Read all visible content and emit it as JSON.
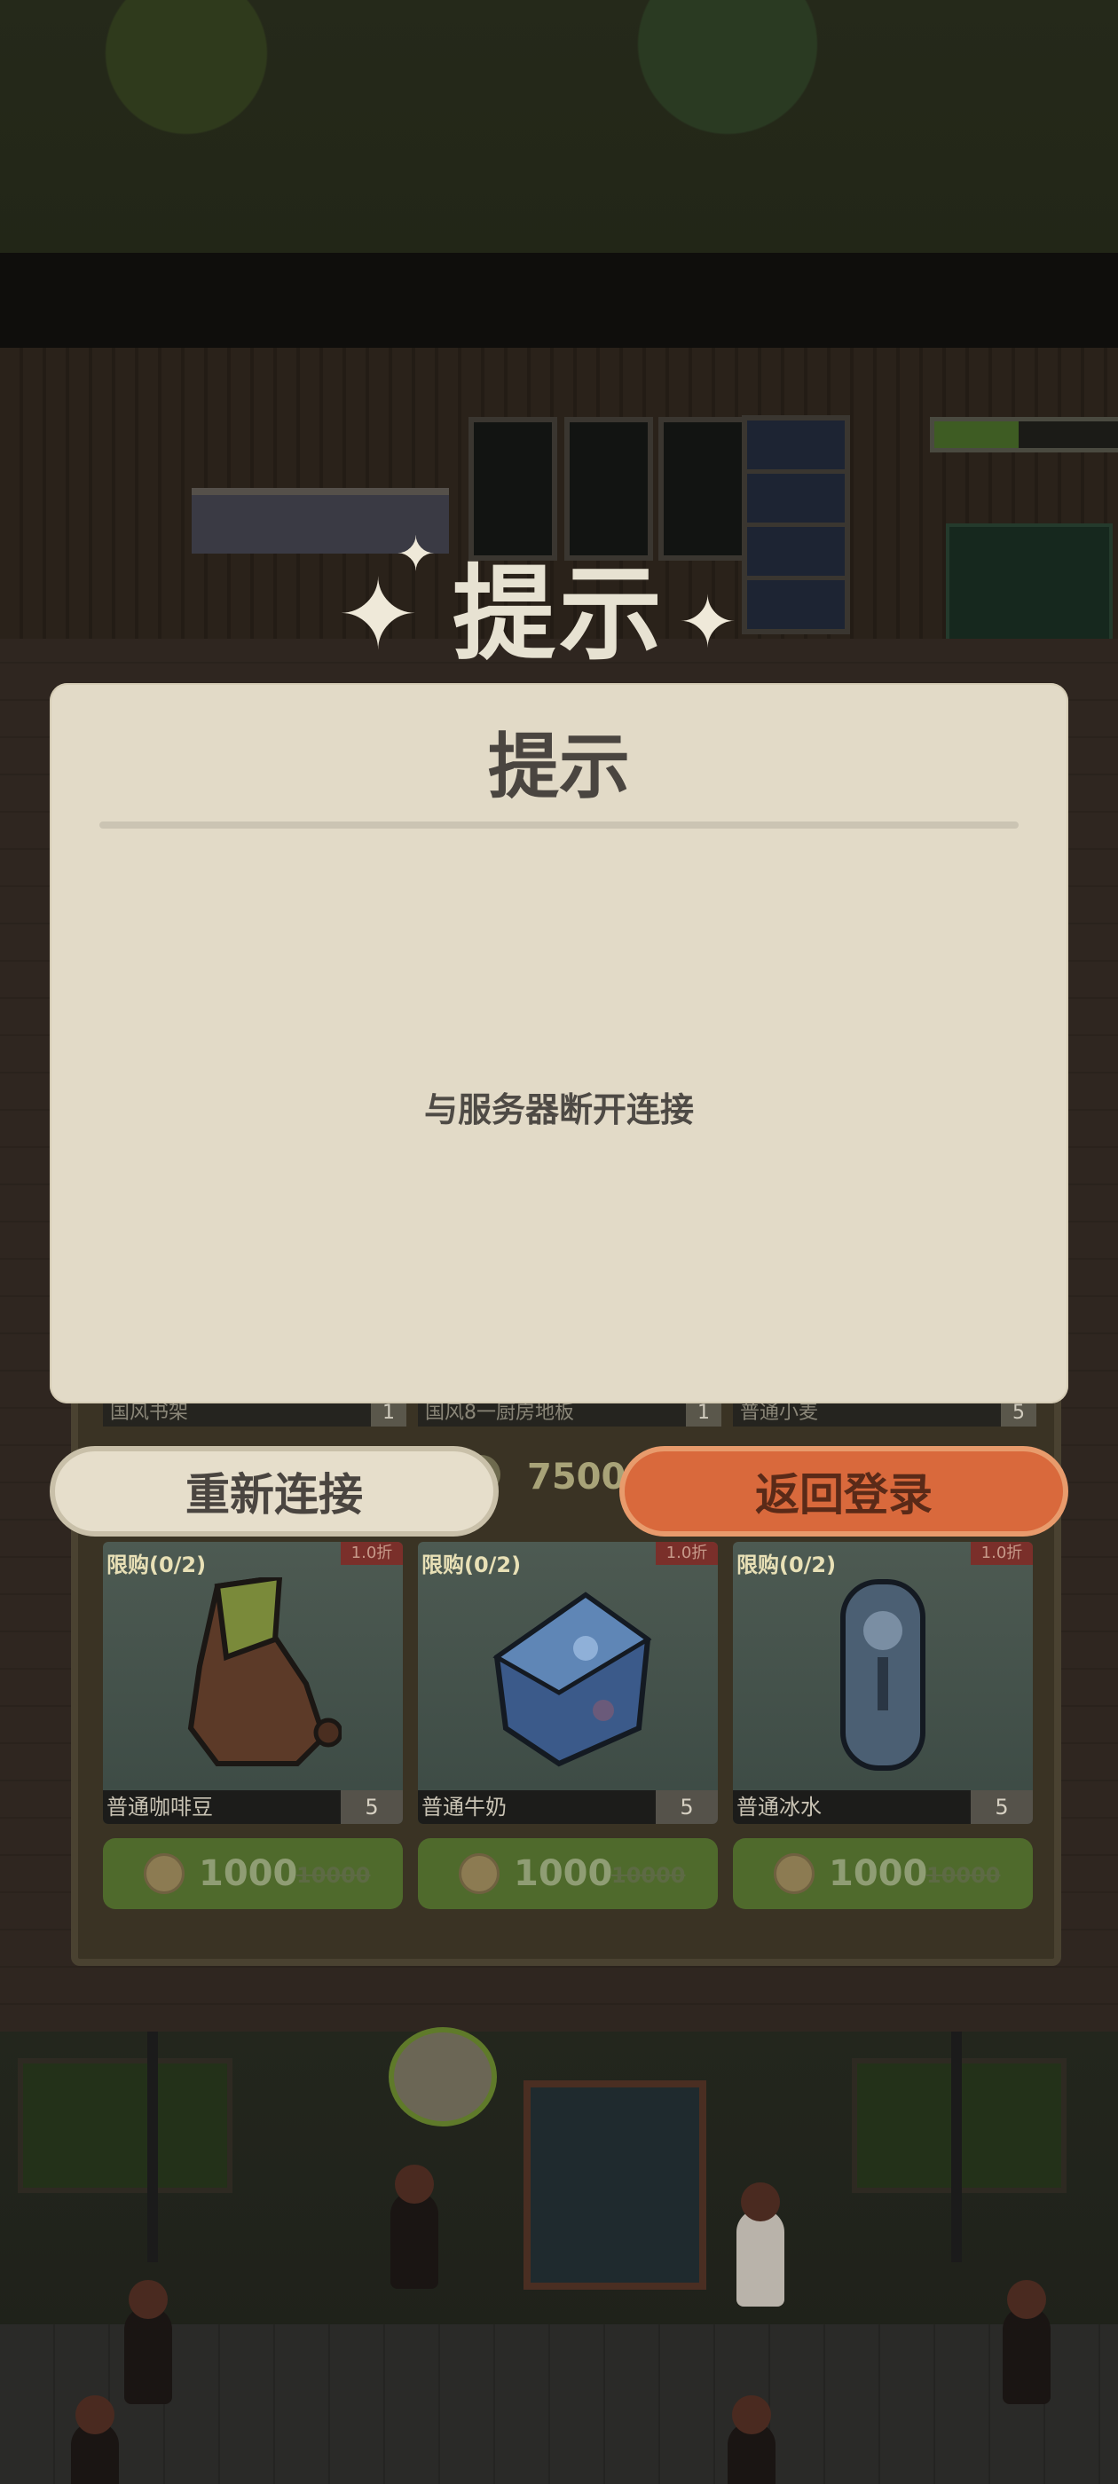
{
  "banner": {
    "title": "提示"
  },
  "dialog": {
    "title": "提示",
    "message": "与服务器断开连接"
  },
  "buttons": {
    "reconnect": "重新连接",
    "back_to_login": "返回登录"
  },
  "hud": {
    "progress_fraction": 0.45
  },
  "shop": {
    "peek_rows": [
      {
        "name": "国风书架",
        "count": "1"
      },
      {
        "name": "国风8一厨房地板",
        "count": "1"
      },
      {
        "name": "普通小麦",
        "count": "5"
      }
    ],
    "peek_price": "7500",
    "items": [
      {
        "limit": "限购(0/2)",
        "discount": "1.0折",
        "name": "普通咖啡豆",
        "count": "5",
        "price": "1000",
        "old_price": "10000",
        "icon": "coffee-bean-sack-icon"
      },
      {
        "limit": "限购(0/2)",
        "discount": "1.0折",
        "name": "普通牛奶",
        "count": "5",
        "price": "1000",
        "old_price": "10000",
        "icon": "milk-carton-icon"
      },
      {
        "limit": "限购(0/2)",
        "discount": "1.0折",
        "name": "普通冰水",
        "count": "5",
        "price": "1000",
        "old_price": "10000",
        "icon": "ice-water-bottle-icon"
      }
    ]
  },
  "colors": {
    "dialog_bg": "#e2dac7",
    "primary_button": "#d9693c",
    "secondary_button": "#e6decb",
    "price_button": "#4f6a2c"
  }
}
